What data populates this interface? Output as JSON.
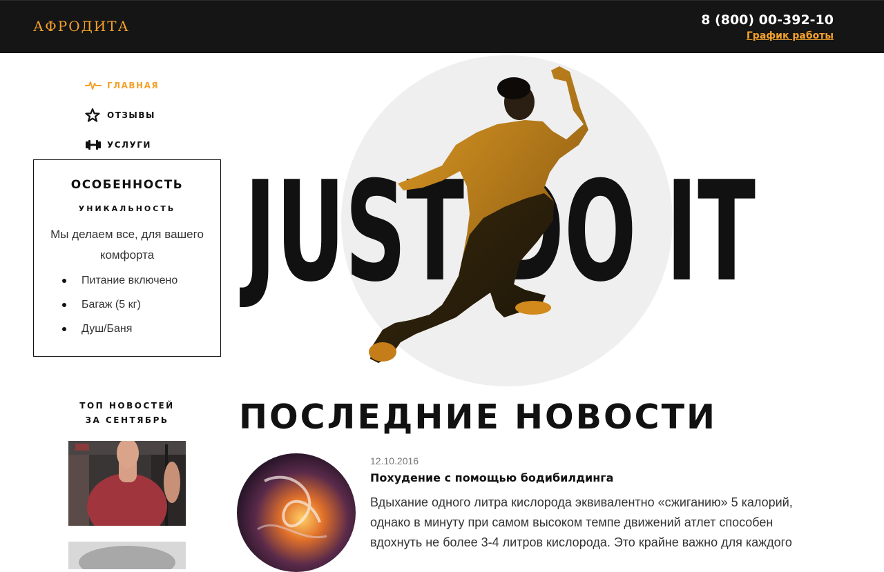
{
  "header": {
    "logo": "АФРОДИТА",
    "phone": "8 (800) 00-392-10",
    "schedule_link": "График работы"
  },
  "nav": {
    "items": [
      {
        "label": "ГЛАВНАЯ",
        "icon": "pulse-icon",
        "active": true
      },
      {
        "label": "ОТЗЫВЫ",
        "icon": "star-icon",
        "active": false
      },
      {
        "label": "УСЛУГИ",
        "icon": "dumbbell-icon",
        "active": false
      }
    ]
  },
  "feature": {
    "title": "ОСОБЕННОСТЬ",
    "subtitle": "УНИКАЛЬНОСТЬ",
    "description": "Мы делаем все, для вашего комфорта",
    "list": [
      "Питание включено",
      "Багаж (5 кг)",
      "Душ/Баня"
    ]
  },
  "top_news": {
    "title_line1": "ТОП НОВОСТЕЙ",
    "title_line2": "ЗА СЕНТЯБРЬ"
  },
  "hero": {
    "slogan": "JUST DO IT"
  },
  "news": {
    "heading": "ПОСЛЕДНИЕ НОВОСТИ",
    "items": [
      {
        "date": "12.10.2016",
        "title": "Похудение с помощью бодибилдинга",
        "text": "Вдыхание одного литра кислорода эквивалентно «сжиганию» 5 калорий, однако в минуту при самом высоком темпе движений атлет способен вдохнуть не более 3-4 литров кислорода. Это крайне важно для каждого"
      }
    ]
  },
  "colors": {
    "accent": "#f4a12b",
    "header_bg": "#151515",
    "text": "#111111"
  }
}
